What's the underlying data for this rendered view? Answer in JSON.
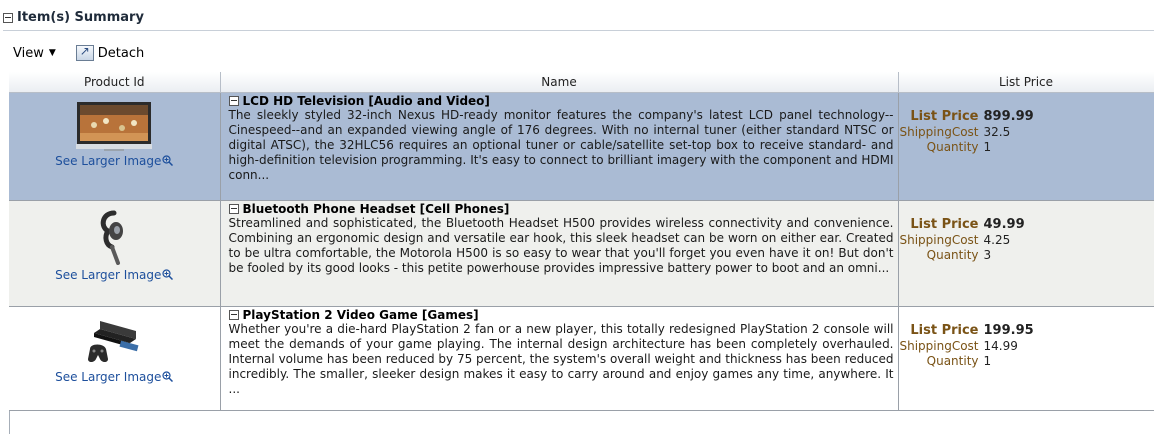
{
  "panel": {
    "title": "Item(s) Summary"
  },
  "toolbar": {
    "view_label": "View",
    "detach_label": "Detach"
  },
  "columns": {
    "product_id": "Product Id",
    "name": "Name",
    "list_price": "List Price"
  },
  "items": [
    {
      "title": "LCD HD Television [Audio and Video]",
      "description": "The sleekly styled 32-inch Nexus HD-ready monitor features the company's latest LCD panel technology--Cinespeed--and an expanded viewing angle of 176 degrees. With no internal tuner (either standard NTSC or digital ATSC), the 32HLC56 requires an optional tuner or cable/satellite set-top box to receive standard- and high-definition television programming. It's easy to connect to brilliant imagery with the component and HDMI conn...",
      "link": "See Larger Image",
      "list_price_label": "List Price",
      "list_price": "899.99",
      "shipping_label": "ShippingCost",
      "shipping": "32.5",
      "quantity_label": "Quantity",
      "quantity": "1"
    },
    {
      "title": "Bluetooth Phone Headset [Cell Phones]",
      "description": "Streamlined and sophisticated, the Bluetooth Headset H500 provides wireless connectivity and convenience. Combining an ergonomic design and versatile ear hook, this sleek headset can be worn on either ear. Created to be ultra comfortable, the Motorola H500 is so easy to wear that you'll forget you even have it on! But don't be fooled by its good looks - this petite powerhouse provides impressive battery power to boot and an omni...",
      "link": "See Larger Image",
      "list_price_label": "List Price",
      "list_price": "49.99",
      "shipping_label": "ShippingCost",
      "shipping": "4.25",
      "quantity_label": "Quantity",
      "quantity": "3"
    },
    {
      "title": "PlayStation 2 Video Game [Games]",
      "description": "Whether you're a die-hard PlayStation 2 fan or a new player, this totally redesigned PlayStation 2 console will meet the demands of your game playing. The internal design architecture has been completely overhauled. Internal volume has been reduced by 75 percent, the system's overall weight and thickness has been reduced incredibly. The smaller, sleeker design makes it easy to carry around and enjoy games any time, anywhere. It ...",
      "link": "See Larger Image",
      "list_price_label": "List Price",
      "list_price": "199.95",
      "shipping_label": "ShippingCost",
      "shipping": "14.99",
      "quantity_label": "Quantity",
      "quantity": "1"
    }
  ],
  "colors": {
    "selected_row": "#aabbd4",
    "alt_row": "#eff0ed",
    "link": "#1d4f9c",
    "price_label": "#7a5316"
  },
  "icons": [
    "collapse-icon",
    "caret-down-icon",
    "detach-icon",
    "zoom-icon",
    "tv-image",
    "headset-image",
    "console-image"
  ]
}
